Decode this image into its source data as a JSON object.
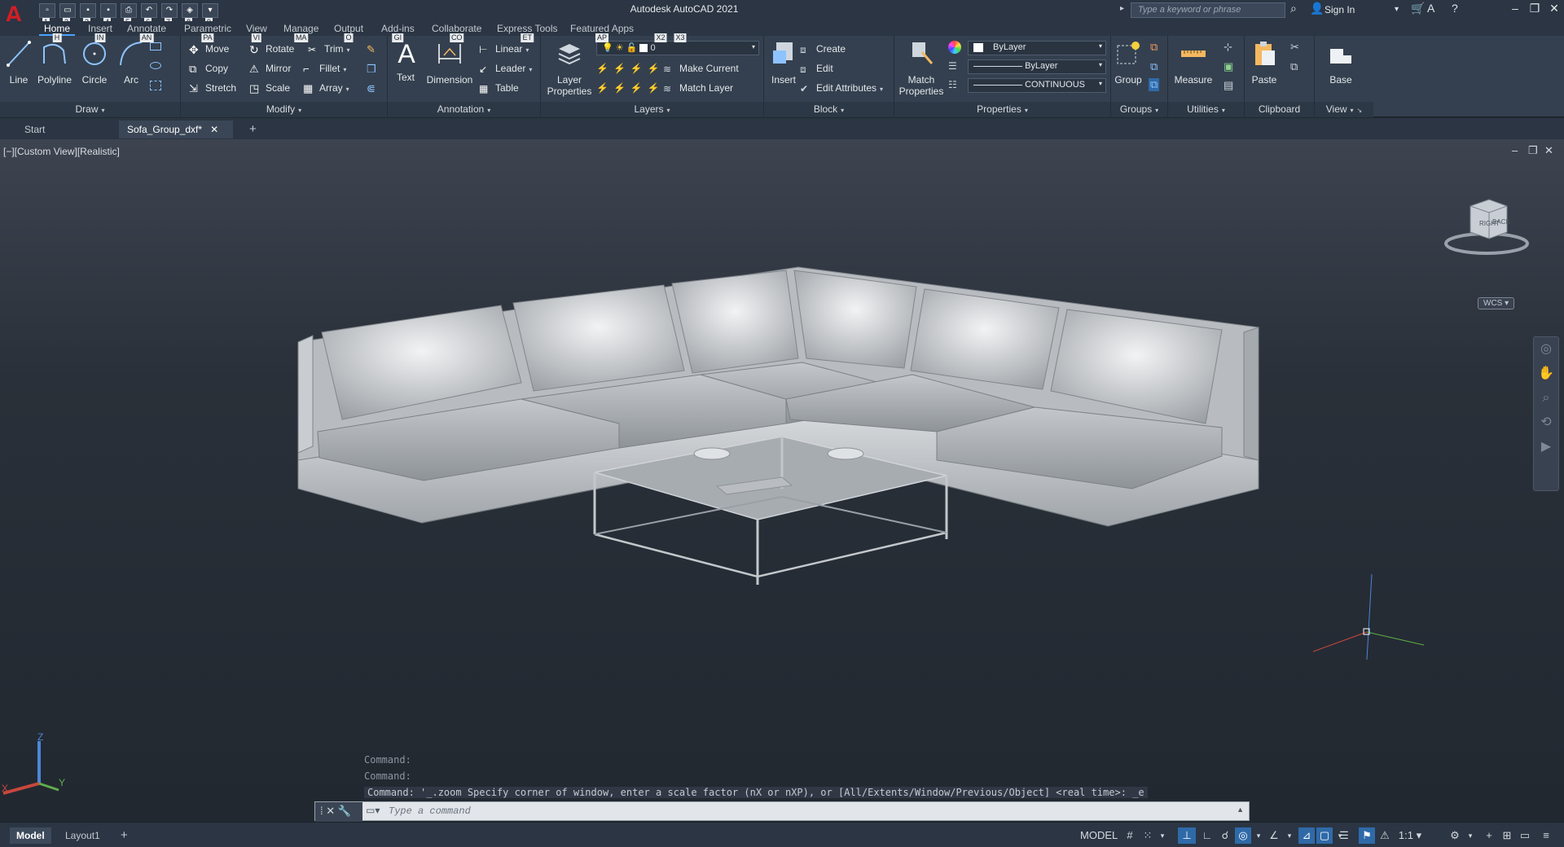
{
  "window": {
    "app_title": "Autodesk AutoCAD 2021",
    "search_placeholder": "Type a keyword or phrase",
    "signin_label": "Sign In"
  },
  "qat": [
    {
      "icon": "new-icon",
      "key": "1"
    },
    {
      "icon": "open-icon",
      "key": "2"
    },
    {
      "icon": "save-icon",
      "key": "3"
    },
    {
      "icon": "saveas-icon",
      "key": "4"
    },
    {
      "icon": "plot-icon",
      "key": "5"
    },
    {
      "icon": "undo-icon",
      "key": "6"
    },
    {
      "icon": "redo-icon",
      "key": "7"
    },
    {
      "icon": "share-icon",
      "key": "8"
    },
    {
      "icon": "workspace-icon",
      "key": "9"
    }
  ],
  "ribbon_tabs": [
    {
      "label": "Home",
      "key": "H"
    },
    {
      "label": "Insert",
      "key": "IN"
    },
    {
      "label": "Annotate",
      "key": "AN"
    },
    {
      "label": "Parametric",
      "key": "PA"
    },
    {
      "label": "View",
      "key": "VI"
    },
    {
      "label": "Manage",
      "key": "MA"
    },
    {
      "label": "Output",
      "key": "O"
    },
    {
      "label": "Add-ins",
      "key": "GI"
    },
    {
      "label": "Collaborate",
      "key": "CO"
    },
    {
      "label": "Express Tools",
      "key": "ET"
    },
    {
      "label": "Featured Apps",
      "key": "AP"
    },
    {
      "label": "",
      "key": "X2"
    },
    {
      "label": "",
      "key": "X3"
    }
  ],
  "panels": {
    "draw": {
      "title": "Draw",
      "line": "Line",
      "polyline": "Polyline",
      "circle": "Circle",
      "arc": "Arc"
    },
    "modify": {
      "title": "Modify",
      "move": "Move",
      "rotate": "Rotate",
      "trim": "Trim",
      "copy": "Copy",
      "mirror": "Mirror",
      "fillet": "Fillet",
      "stretch": "Stretch",
      "scale": "Scale",
      "array": "Array"
    },
    "annotation": {
      "title": "Annotation",
      "text": "Text",
      "dimension": "Dimension",
      "linear": "Linear",
      "leader": "Leader",
      "table": "Table"
    },
    "layers": {
      "title": "Layers",
      "layer_properties_1": "Layer",
      "layer_properties_2": "Properties",
      "current_layer": "0",
      "make_current": "Make Current",
      "match_layer": "Match Layer"
    },
    "block": {
      "title": "Block",
      "insert": "Insert",
      "create": "Create",
      "edit": "Edit",
      "edit_attributes": "Edit Attributes"
    },
    "properties": {
      "title": "Properties",
      "match_1": "Match",
      "match_2": "Properties",
      "color": "ByLayer",
      "lineweight": "ByLayer",
      "linetype": "CONTINUOUS"
    },
    "groups": {
      "title": "Groups",
      "group": "Group"
    },
    "utilities": {
      "title": "Utilities",
      "measure": "Measure"
    },
    "clipboard": {
      "title": "Clipboard",
      "paste": "Paste"
    },
    "view": {
      "title": "View",
      "base": "Base"
    }
  },
  "doc_tabs": {
    "start": "Start",
    "active": "Sofa_Group_dxf*"
  },
  "viewport": {
    "label": "[−][Custom View][Realistic]",
    "viewcube_right": "RIGHT",
    "viewcube_back": "BACK",
    "wcs": "WCS",
    "ucs_z": "Z",
    "ucs_y": "Y",
    "ucs_x": "X"
  },
  "command": {
    "history": [
      "Command:",
      "Command:"
    ],
    "last": "Command: '_.zoom Specify corner of window, enter a scale factor (nX or nXP), or [All/Extents/Window/Previous/Object] <real time>: _e",
    "placeholder": "Type a command"
  },
  "statusbar": {
    "model_tab": "Model",
    "layout_tab": "Layout1",
    "model_space": "MODEL",
    "annotation_scale": "1:1"
  },
  "colors": {
    "accent": "#2f6aa8",
    "logo": "#d11f26",
    "viewport_bg": "#212830",
    "ribbon_bg": "#34404f"
  }
}
